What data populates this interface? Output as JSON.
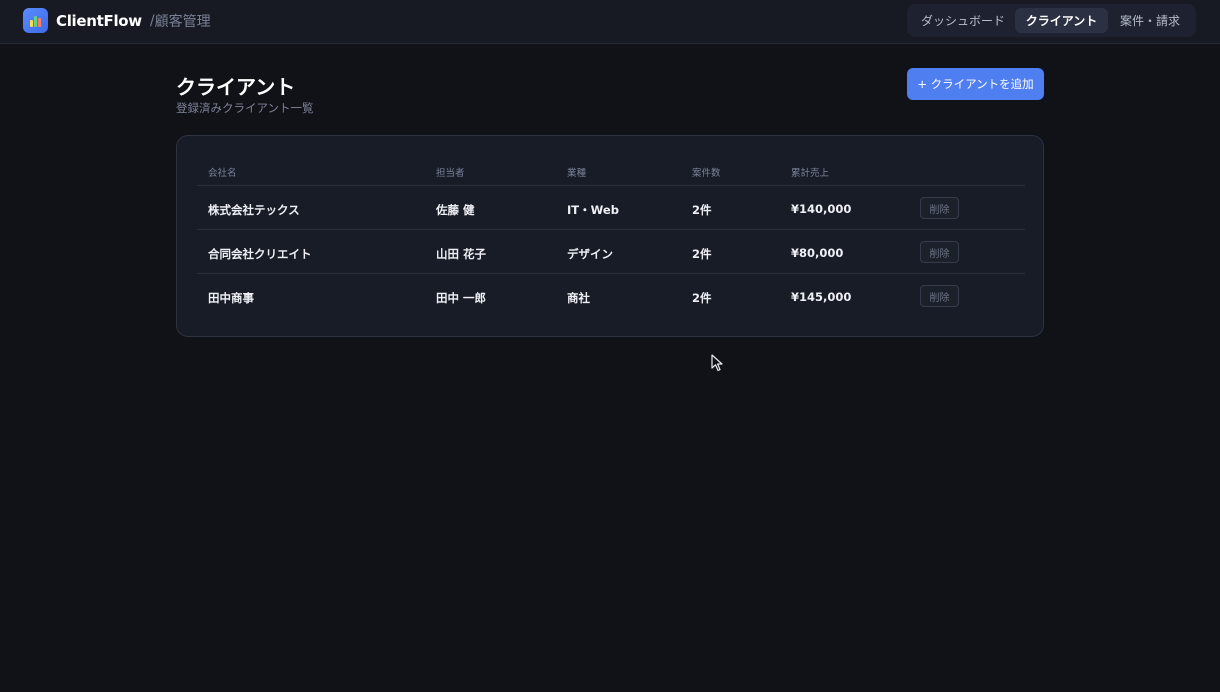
{
  "header": {
    "brand_name": "ClientFlow",
    "separator": "/",
    "section": "顧客管理",
    "tabs": [
      {
        "label": "ダッシュボード",
        "active": false
      },
      {
        "label": "クライアント",
        "active": true
      },
      {
        "label": "案件・請求",
        "active": false
      }
    ]
  },
  "page": {
    "title": "クライアント",
    "subtitle": "登録済みクライアント一覧",
    "add_button": "+ クライアントを追加"
  },
  "table": {
    "columns": [
      "会社名",
      "担当者",
      "業種",
      "案件数",
      "累計売上"
    ],
    "rows": [
      {
        "company": "株式会社テックス",
        "contact": "佐藤 健",
        "industry": "IT・Web",
        "projects": "2件",
        "revenue": "¥140,000",
        "action": "削除"
      },
      {
        "company": "合同会社クリエイト",
        "contact": "山田 花子",
        "industry": "デザイン",
        "projects": "2件",
        "revenue": "¥80,000",
        "action": "削除"
      },
      {
        "company": "田中商事",
        "contact": "田中 一郎",
        "industry": "商社",
        "projects": "2件",
        "revenue": "¥145,000",
        "action": "削除"
      }
    ]
  },
  "colors": {
    "background": "#111218",
    "accent": "#4f7ef0",
    "card": "#181c27"
  }
}
